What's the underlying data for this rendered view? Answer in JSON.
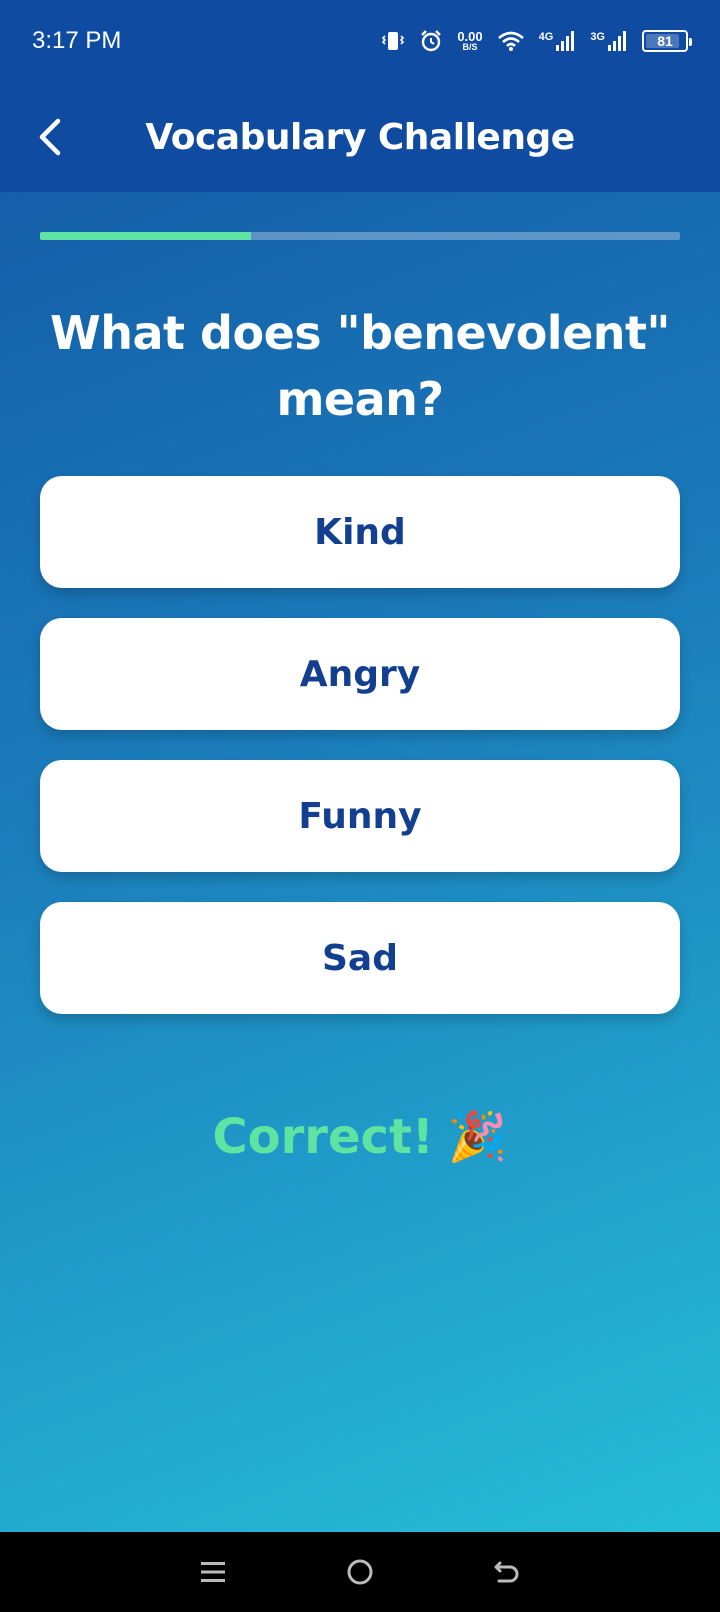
{
  "status_bar": {
    "time": "3:17 PM",
    "net_speed_value": "0.00",
    "net_speed_unit": "B/S",
    "signal_1_label": "4G",
    "signal_2_label": "3G",
    "battery_level": "81",
    "icons": [
      "vibrate-icon",
      "alarm-icon",
      "wifi-icon",
      "signal-icon",
      "battery-icon"
    ]
  },
  "header": {
    "title": "Vocabulary Challenge",
    "back_icon": "back-arrow-icon"
  },
  "progress": {
    "fraction": 0.33,
    "color": "#5ee3a2"
  },
  "question": {
    "text": "What does \"benevolent\" mean?"
  },
  "options": [
    {
      "label": "Kind"
    },
    {
      "label": "Angry"
    },
    {
      "label": "Funny"
    },
    {
      "label": "Sad"
    }
  ],
  "feedback": {
    "text": "Correct!",
    "emoji": "🎉"
  },
  "nav_bar": {
    "icons": [
      "menu-icon",
      "home-icon",
      "back-icon"
    ]
  },
  "colors": {
    "header_bg": "#0f4ba1",
    "accent_green": "#5ee3a2",
    "option_text": "#123f8f"
  }
}
